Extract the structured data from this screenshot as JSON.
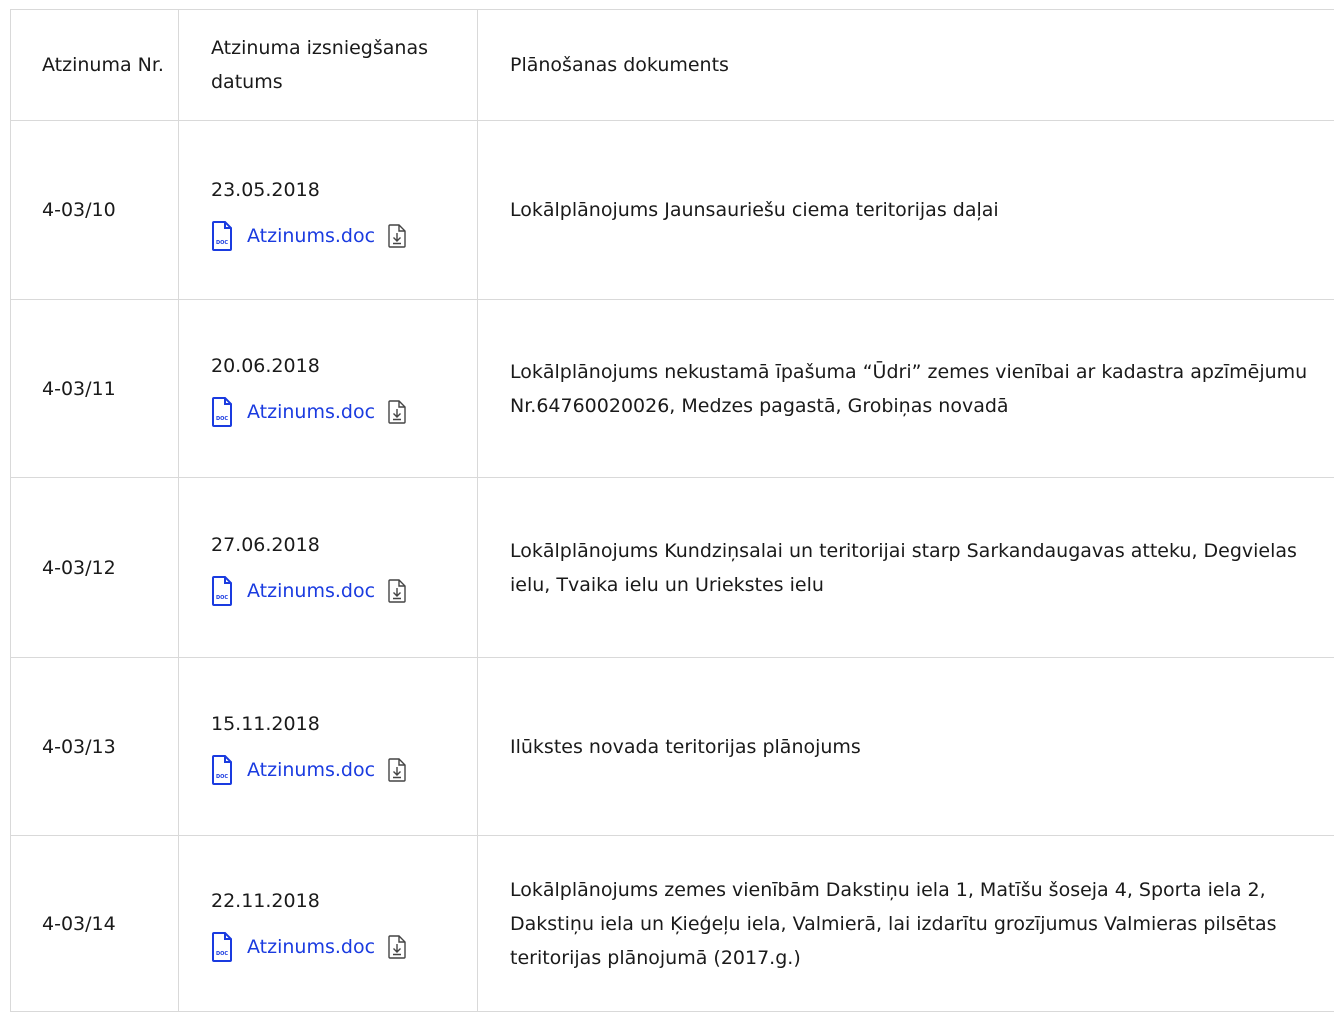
{
  "header": {
    "col1": "Atzinuma Nr.",
    "col2": "Atzinuma izsniegšanas datums",
    "col3": "Plānošanas dokuments"
  },
  "rows": [
    {
      "nr": "4-03/10",
      "date": "23.05.2018",
      "file": "Atzinums.doc",
      "doc": "Lokālplānojums Jaunsauriešu ciema teritorijas daļai"
    },
    {
      "nr": "4-03/11",
      "date": "20.06.2018",
      "file": "Atzinums.doc",
      "doc": "Lokālplānojums nekustamā īpašuma “Ūdri” zemes vienībai ar kadastra apzīmējumu Nr.64760020026, Medzes pagastā, Grobiņas novadā"
    },
    {
      "nr": "4-03/12",
      "date": "27.06.2018",
      "file": "Atzinums.doc",
      "doc": "Lokālplānojums Kundziņsalai un teritorijai starp Sarkandaugavas atteku, Degvielas ielu, Tvaika ielu un Uriekstes ielu"
    },
    {
      "nr": "4-03/13",
      "date": "15.11.2018",
      "file": "Atzinums.doc",
      "doc": "Ilūkstes novada teritorijas plānojums"
    },
    {
      "nr": "4-03/14",
      "date": "22.11.2018",
      "file": "Atzinums.doc",
      "doc": "Lokālplānojums zemes vienībām Dakstiņu iela 1, Matīšu šoseja 4, Sporta iela 2, Dakstiņu iela un Ķieģeļu iela, Valmierā, lai izdarītu grozījumus Valmieras pilsētas teritorijas plānojumā (2017.g.)"
    }
  ],
  "icons": {
    "file_icon": "doc-file-icon",
    "file_icon_text": "DOC",
    "download_icon": "download-icon"
  },
  "colors": {
    "link": "#1a3be0",
    "border": "#d9d9d9"
  }
}
